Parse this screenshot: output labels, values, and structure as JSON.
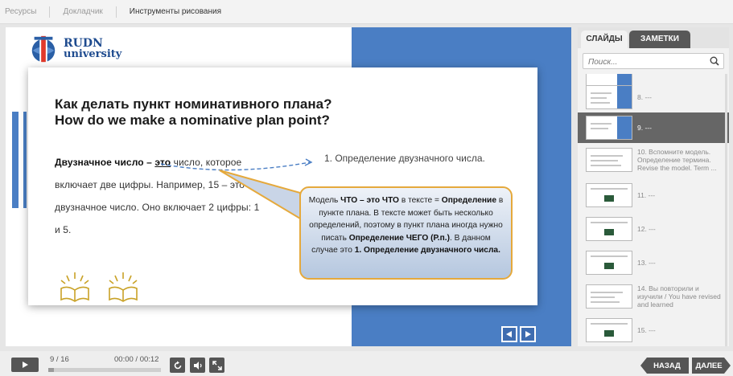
{
  "topnav": {
    "items": [
      "Ресурсы",
      "Докладчик",
      "Инструменты рисования"
    ]
  },
  "logo": {
    "line1": "RUDN",
    "line2": "university"
  },
  "slide": {
    "title_line1": "Как делать пункт номинативного плана?",
    "title_line2": "How do we make a nominative plan point?",
    "para_bold": "Двузначное число – ",
    "para_bold_u": "это",
    "para_rest": " число, которое включает две цифры. Например, 15 – это двузначное число. Оно включает 2 цифры: 1 и 5.",
    "plan_point": "1. Определение двузначного числа.",
    "callout": {
      "t1": "Модель ",
      "b1": "ЧТО – это ЧТО",
      "t2": " в тексте = ",
      "b2": "Определение",
      "t3": " в пункте плана. В тексте может быть несколько определений, поэтому в пункт плана иногда нужно писать ",
      "b3": "Определение ЧЕГО (Р.п.)",
      "t4": ". В данном случае это ",
      "b4": "1. Определение двузначного числа."
    },
    "accent_color": "#4a7ec4",
    "callout_border": "#e5a93c"
  },
  "sidebar": {
    "tab_slides": "СЛАЙДЫ",
    "tab_notes": "ЗАМЕТКИ",
    "search_placeholder": "Поиск...",
    "thumbs": [
      {
        "label": "8. ---"
      },
      {
        "label": "9. ---",
        "selected": true
      },
      {
        "label": "10. Вспомните модель. Определение термина. Revise the model. Term ..."
      },
      {
        "label": "11. ---"
      },
      {
        "label": "12. ---"
      },
      {
        "label": "13. ---"
      },
      {
        "label": "14. Вы повторили и изучили / You have revised and learned"
      },
      {
        "label": "15. ---"
      }
    ]
  },
  "player": {
    "counter": "9 / 16",
    "time": "00:00 / 00:12",
    "progress": 0.05,
    "back_label": "НАЗАД",
    "next_label": "ДАЛЕЕ"
  }
}
